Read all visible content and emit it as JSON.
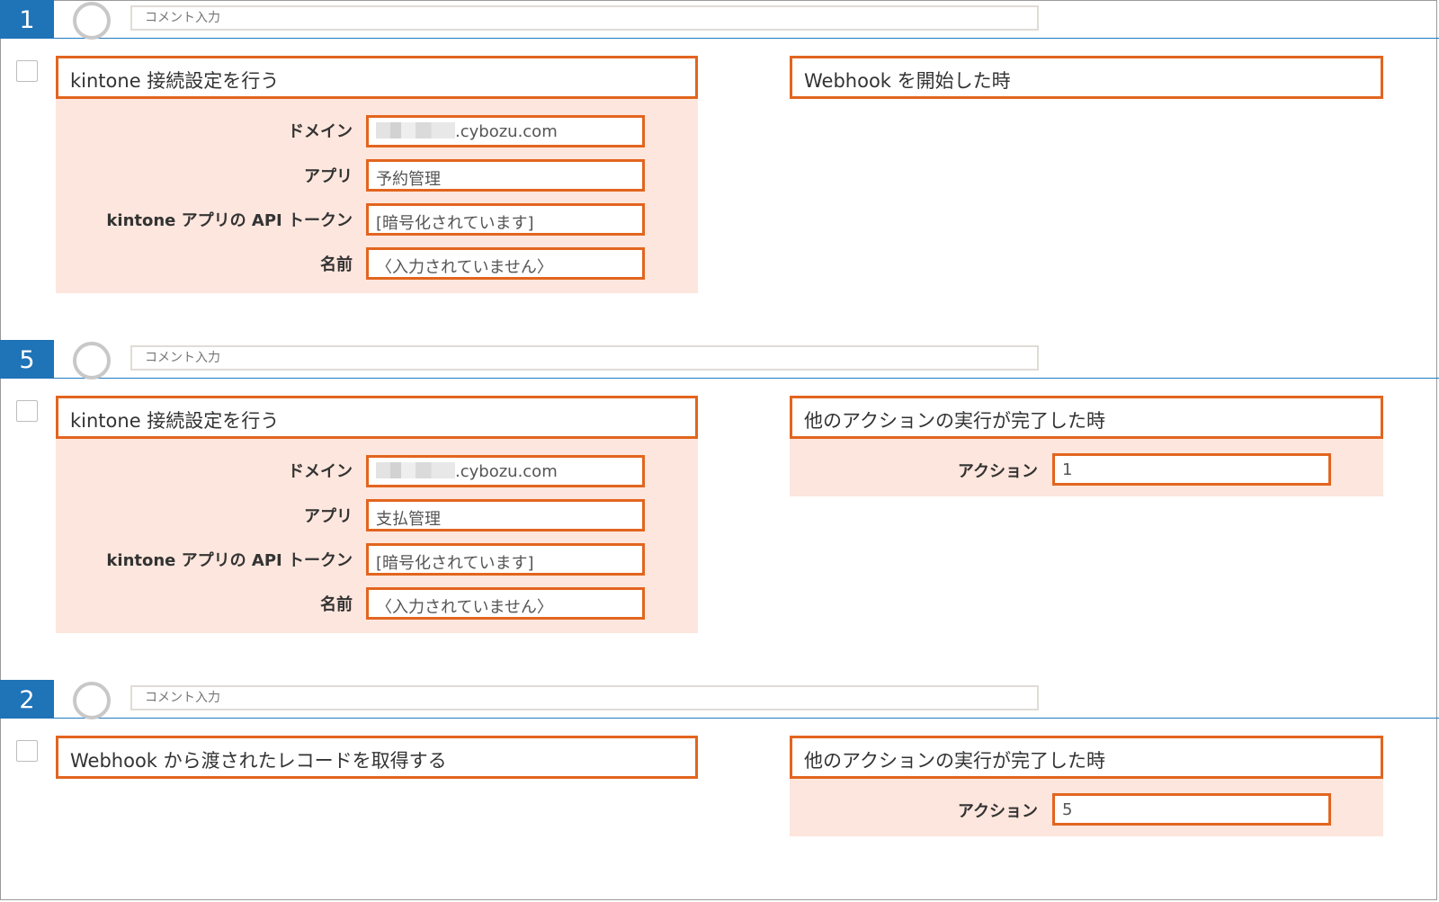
{
  "steps": [
    {
      "number": "1",
      "comment_placeholder": "コメント入力",
      "left_title": "kintone 接続設定を行う",
      "fields": [
        {
          "label": "ドメイン",
          "value": ".cybozu.com"
        },
        {
          "label": "アプリ",
          "value": "予約管理"
        },
        {
          "label": "kintone アプリの API トークン",
          "value": "[暗号化されています]"
        },
        {
          "label": "名前",
          "value": "〈入力されていません〉"
        }
      ],
      "right_title": "Webhook を開始した時"
    },
    {
      "number": "5",
      "comment_placeholder": "コメント入力",
      "left_title": "kintone 接続設定を行う",
      "fields": [
        {
          "label": "ドメイン",
          "value": ".cybozu.com"
        },
        {
          "label": "アプリ",
          "value": "支払管理"
        },
        {
          "label": "kintone アプリの API トークン",
          "value": "[暗号化されています]"
        },
        {
          "label": "名前",
          "value": "〈入力されていません〉"
        }
      ],
      "right_title": "他のアクションの実行が完了した時",
      "right_field": {
        "label": "アクション",
        "value": "1"
      }
    },
    {
      "number": "2",
      "comment_placeholder": "コメント入力",
      "left_title": "Webhook から渡されたレコードを取得する",
      "right_title": "他のアクションの実行が完了した時",
      "right_field": {
        "label": "アクション",
        "value": "5"
      }
    }
  ]
}
